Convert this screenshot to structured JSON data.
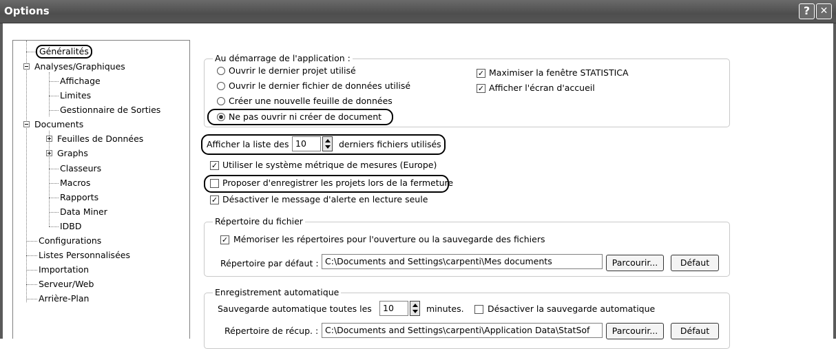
{
  "window": {
    "title": "Options",
    "help_glyph": "?",
    "close_glyph": "✕"
  },
  "tree": {
    "items": [
      {
        "label": "Généralités"
      },
      {
        "label": "Analyses/Graphiques"
      },
      {
        "label": "Affichage"
      },
      {
        "label": "Limites"
      },
      {
        "label": "Gestionnaire de Sorties"
      },
      {
        "label": "Documents"
      },
      {
        "label": "Feuilles de Données"
      },
      {
        "label": "Graphs"
      },
      {
        "label": "Classeurs"
      },
      {
        "label": "Macros"
      },
      {
        "label": "Rapports"
      },
      {
        "label": "Data Miner"
      },
      {
        "label": "IDBD"
      },
      {
        "label": "Configurations"
      },
      {
        "label": "Listes Personnalisées"
      },
      {
        "label": "Importation"
      },
      {
        "label": "Serveur/Web"
      },
      {
        "label": "Arrière-Plan"
      }
    ]
  },
  "startup": {
    "legend": "Au démarrage de l'application :",
    "radio1": "Ouvrir le dernier projet utilisé",
    "radio2": "Ouvrir le dernier fichier de données utilisé",
    "radio3": "Créer une nouvelle feuille de données",
    "radio4": "Ne pas ouvrir ni créer de document",
    "selected": "radio4",
    "check_maximize": "Maximiser la fenêtre STATISTICA",
    "check_splash": "Afficher l'écran d'accueil"
  },
  "recent": {
    "before": "Afficher la liste des",
    "value": "10",
    "after": "derniers fichiers utilisés"
  },
  "options": {
    "metric": "Utiliser le système métrique de mesures (Europe)",
    "save_projects": "Proposer d'enregistrer les projets lors de la fermeture",
    "readonly_alert": "Désactiver le message d'alerte en lecture seule"
  },
  "directory": {
    "legend": "Répertoire du fichier",
    "remember": "Mémoriser les répertoires pour l'ouverture ou la sauvegarde des fichiers",
    "default_label": "Répertoire par défaut :",
    "default_value": "C:\\Documents and Settings\\carpenti\\Mes documents",
    "browse": "Parcourir...",
    "default_btn": "Défaut"
  },
  "autosave": {
    "legend": "Enregistrement automatique",
    "before": "Sauvegarde automatique toutes les",
    "value": "10",
    "after": "minutes.",
    "disable": "Désactiver la sauvegarde automatique",
    "recovery_label": "Répertoire de récup. :",
    "recovery_value": "C:\\Documents and Settings\\carpenti\\Application Data\\StatSof",
    "browse": "Parcourir...",
    "default_btn": "Défaut"
  }
}
